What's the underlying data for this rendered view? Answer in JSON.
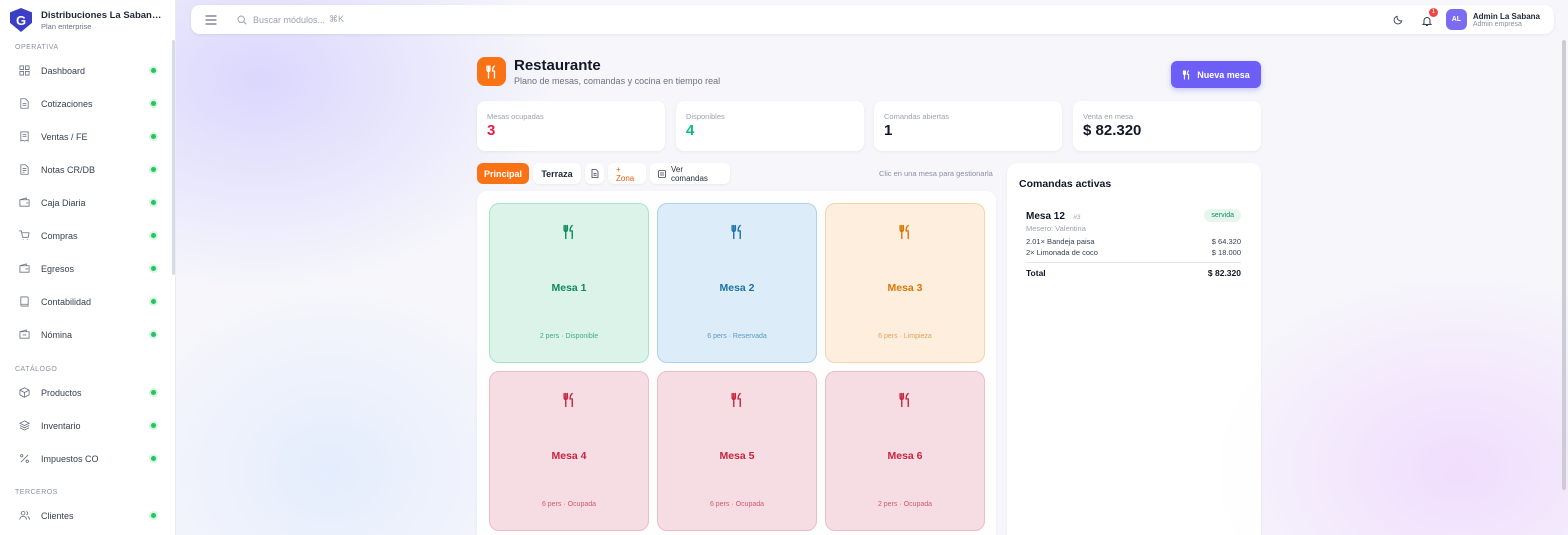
{
  "brand": {
    "name": "Distribuciones La Sabana S.A.S",
    "plan": "Plan enterprise",
    "logo_letter": "G"
  },
  "sidebar": {
    "sections": [
      {
        "label": "OPERATIVA",
        "items": [
          {
            "label": "Dashboard",
            "icon": "grid-icon"
          },
          {
            "label": "Cotizaciones",
            "icon": "document-icon"
          },
          {
            "label": "Ventas / FE",
            "icon": "receipt-icon"
          },
          {
            "label": "Notas CR/DB",
            "icon": "notes-icon"
          },
          {
            "label": "Caja Diaria",
            "icon": "wallet-icon"
          },
          {
            "label": "Compras",
            "icon": "cart-icon"
          },
          {
            "label": "Egresos",
            "icon": "wallet-out-icon"
          },
          {
            "label": "Contabilidad",
            "icon": "book-icon"
          },
          {
            "label": "Nómina",
            "icon": "payroll-icon"
          }
        ]
      },
      {
        "label": "CATÁLOGO",
        "items": [
          {
            "label": "Productos",
            "icon": "box-icon"
          },
          {
            "label": "Inventario",
            "icon": "layers-icon"
          },
          {
            "label": "Impuestos CO",
            "icon": "percent-icon"
          }
        ]
      },
      {
        "label": "TERCEROS",
        "items": [
          {
            "label": "Clientes",
            "icon": "users-icon"
          }
        ]
      }
    ]
  },
  "topbar": {
    "search_placeholder": "Buscar módulos...",
    "search_shortcut": "⌘K",
    "notifications": "1",
    "user": {
      "initials": "AL",
      "name": "Admin La Sabana",
      "role": "Admin empresa"
    }
  },
  "page": {
    "title": "Restaurante",
    "subtitle": "Plano de mesas, comandas y cocina en tiempo real",
    "new_button": "Nueva mesa",
    "accent": "#f97316"
  },
  "stats": [
    {
      "label": "Mesas ocupadas",
      "value": "3",
      "color": "#e11d48"
    },
    {
      "label": "Disponibles",
      "value": "4",
      "color": "#10b981"
    },
    {
      "label": "Comandas abiertas",
      "value": "1",
      "color": "#111827"
    },
    {
      "label": "Venta en mesa",
      "value": "$ 82.320",
      "color": "#111827"
    }
  ],
  "zones": {
    "tabs": [
      "Principal",
      "Terraza"
    ],
    "add_zone": "+ Zona",
    "view_orders": "Ver comandas",
    "hint": "Clic en una mesa para gestionarla"
  },
  "tables": [
    {
      "name": "Mesa 1",
      "info": "2 pers · Disponible",
      "status": "green"
    },
    {
      "name": "Mesa 2",
      "info": "6 pers · Reservada",
      "status": "blue"
    },
    {
      "name": "Mesa 3",
      "info": "6 pers · Limpieza",
      "status": "orange"
    },
    {
      "name": "Mesa 4",
      "info": "6 pers · Ocupada",
      "status": "red"
    },
    {
      "name": "Mesa 5",
      "info": "6 pers · Ocupada",
      "status": "red"
    },
    {
      "name": "Mesa 6",
      "info": "2 pers · Ocupada",
      "status": "red"
    }
  ],
  "orders": {
    "title": "Comandas activas",
    "items": [
      {
        "table": "Mesa 12",
        "number": "#3",
        "status": "servida",
        "waiter": "Mesero: Valentina",
        "lines": [
          {
            "desc": "2.01× Bandeja paisa",
            "amount": "$ 64.320"
          },
          {
            "desc": "2× Limonada de coco",
            "amount": "$ 18.000"
          }
        ],
        "total_label": "Total",
        "total": "$ 82.320"
      }
    ]
  }
}
